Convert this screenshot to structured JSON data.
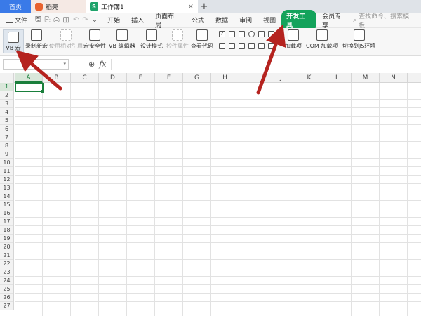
{
  "tabs": {
    "home": "首页",
    "daoke": "稻壳",
    "document": "工作簿1",
    "close": "×",
    "add": "+"
  },
  "menu": {
    "file": "文件",
    "items": [
      "开始",
      "插入",
      "页面布局",
      "公式",
      "数据",
      "审阅",
      "视图",
      "开发工具",
      "会员专享"
    ],
    "active_index": 7,
    "search_placeholder": "查找命令、搜索模板"
  },
  "ribbon": {
    "vb_macro": "VB 宏",
    "record_macro": "录制新宏",
    "relative_ref": "使用相对引用",
    "macro_security": "宏安全性",
    "vb_editor": "VB 编辑器",
    "design_mode": "设计模式",
    "control_props": "控件属性",
    "view_code": "查看代码",
    "addins": "加载项",
    "com_addins": "COM 加载项",
    "switch_js": "切换到JS环境"
  },
  "formula_bar": {
    "name_box_value": "",
    "fx_label": "fx",
    "formula_value": ""
  },
  "sheet": {
    "columns": [
      "A",
      "B",
      "C",
      "D",
      "E",
      "F",
      "G",
      "H",
      "I",
      "J",
      "K",
      "L",
      "M",
      "N"
    ],
    "rows": [
      "1",
      "2",
      "3",
      "4",
      "5",
      "6",
      "7",
      "8",
      "9",
      "10",
      "11",
      "12",
      "13",
      "14",
      "15",
      "16",
      "17",
      "18",
      "19",
      "20",
      "21",
      "22",
      "23",
      "24",
      "25",
      "26",
      "27"
    ],
    "active_cell": "A1"
  },
  "colors": {
    "accent_green": "#13a35b",
    "home_tab": "#3a7ae8",
    "arrow_red": "#b5231f"
  }
}
